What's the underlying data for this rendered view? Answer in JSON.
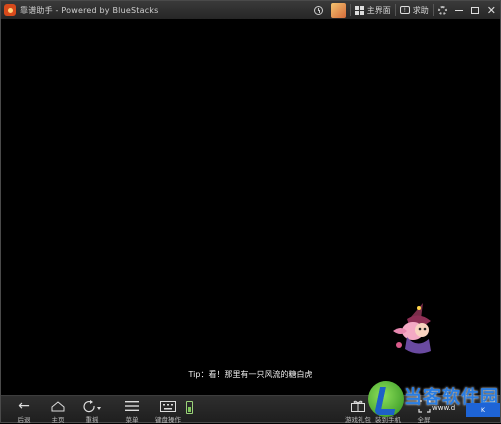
{
  "window": {
    "title": "靠谱助手 - Powered by BlueStacks"
  },
  "titlebar": {
    "home_label": "主界面",
    "help_label": "求助"
  },
  "game": {
    "tip_text": "Tip：看！那里有一只风流的糖白虎"
  },
  "bottombar": {
    "back_label": "后退",
    "home_label": "主页",
    "rotate_label": "重摇",
    "menu_label": "菜单",
    "keyboard_label": "键盘操作",
    "gift_label": "游戏礼包",
    "phone_label": "装到手机",
    "fullscreen_label": "全屏"
  },
  "watermark": {
    "text": "当客软件园",
    "url": "www.d",
    "box": "K"
  },
  "colors": {
    "titlebar": "#2b2b2b",
    "screen": "#000000",
    "bottombar": "#262626",
    "watermark_blue": "#2a7de1",
    "watermark_green": "#4cb82e"
  },
  "icons": [
    "app-icon",
    "clock-icon",
    "avatar",
    "home-grid-icon",
    "help-icon",
    "gear-icon",
    "minimize-icon",
    "maximize-icon",
    "close-icon",
    "back-arrow-icon",
    "home-icon",
    "rotate-icon",
    "menu-icon",
    "keyboard-icon",
    "phone-icon",
    "gift-icon",
    "fullscreen-icon"
  ]
}
